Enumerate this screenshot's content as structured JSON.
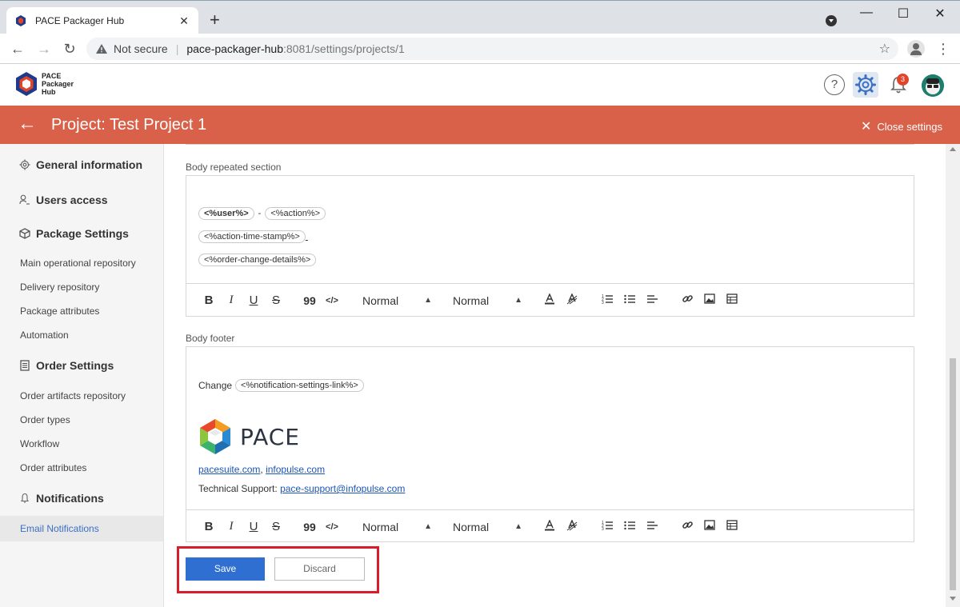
{
  "browser": {
    "tab_title": "PACE Packager Hub",
    "new_tab": "+",
    "not_secure": "Not secure",
    "url_host": "pace-packager-hub",
    "url_rest": ":8081/settings/projects/1"
  },
  "app": {
    "logo_text": [
      "PACE",
      "Packager",
      "Hub"
    ],
    "help": "?",
    "notification_count": "3"
  },
  "titlebar": {
    "back": "←",
    "title": "Project: Test Project 1",
    "close_settings": "Close settings"
  },
  "sidebar": {
    "general_information": "General information",
    "users_access": "Users access",
    "package_settings": "Package Settings",
    "package_items": [
      "Main operational repository",
      "Delivery repository",
      "Package attributes",
      "Automation"
    ],
    "order_settings": "Order Settings",
    "order_items": [
      "Order artifacts repository",
      "Order types",
      "Workflow",
      "Order attributes"
    ],
    "notifications": "Notifications",
    "email_notifications": "Email Notifications"
  },
  "body_repeated": {
    "label": "Body repeated section",
    "chip_user": "<%user%>",
    "dash": "-",
    "chip_action": "<%action%>",
    "chip_timestamp": "<%action-time-stamp%>",
    "chip_details": "<%order-change-details%>"
  },
  "body_footer": {
    "label": "Body footer",
    "change_text": "Change",
    "chip_settings_link": "<%notification-settings-link%>",
    "brand": "PACE",
    "link_pacesuite": "pacesuite.com",
    "comma": ",",
    "link_infopulse": "infopulse.com",
    "support_label": "Technical Support:",
    "support_email": "pace-support@infopulse.com"
  },
  "toolbar": {
    "bold": "B",
    "italic": "I",
    "underline": "U",
    "strike": "S",
    "quote": "99",
    "code": "</>",
    "header_select": "Normal",
    "size_select": "Normal"
  },
  "actions": {
    "save": "Save",
    "discard": "Discard"
  },
  "colors": {
    "accent_bar": "#d9614a",
    "save_button": "#2f6fd1",
    "highlight_frame": "#d81e2a"
  }
}
